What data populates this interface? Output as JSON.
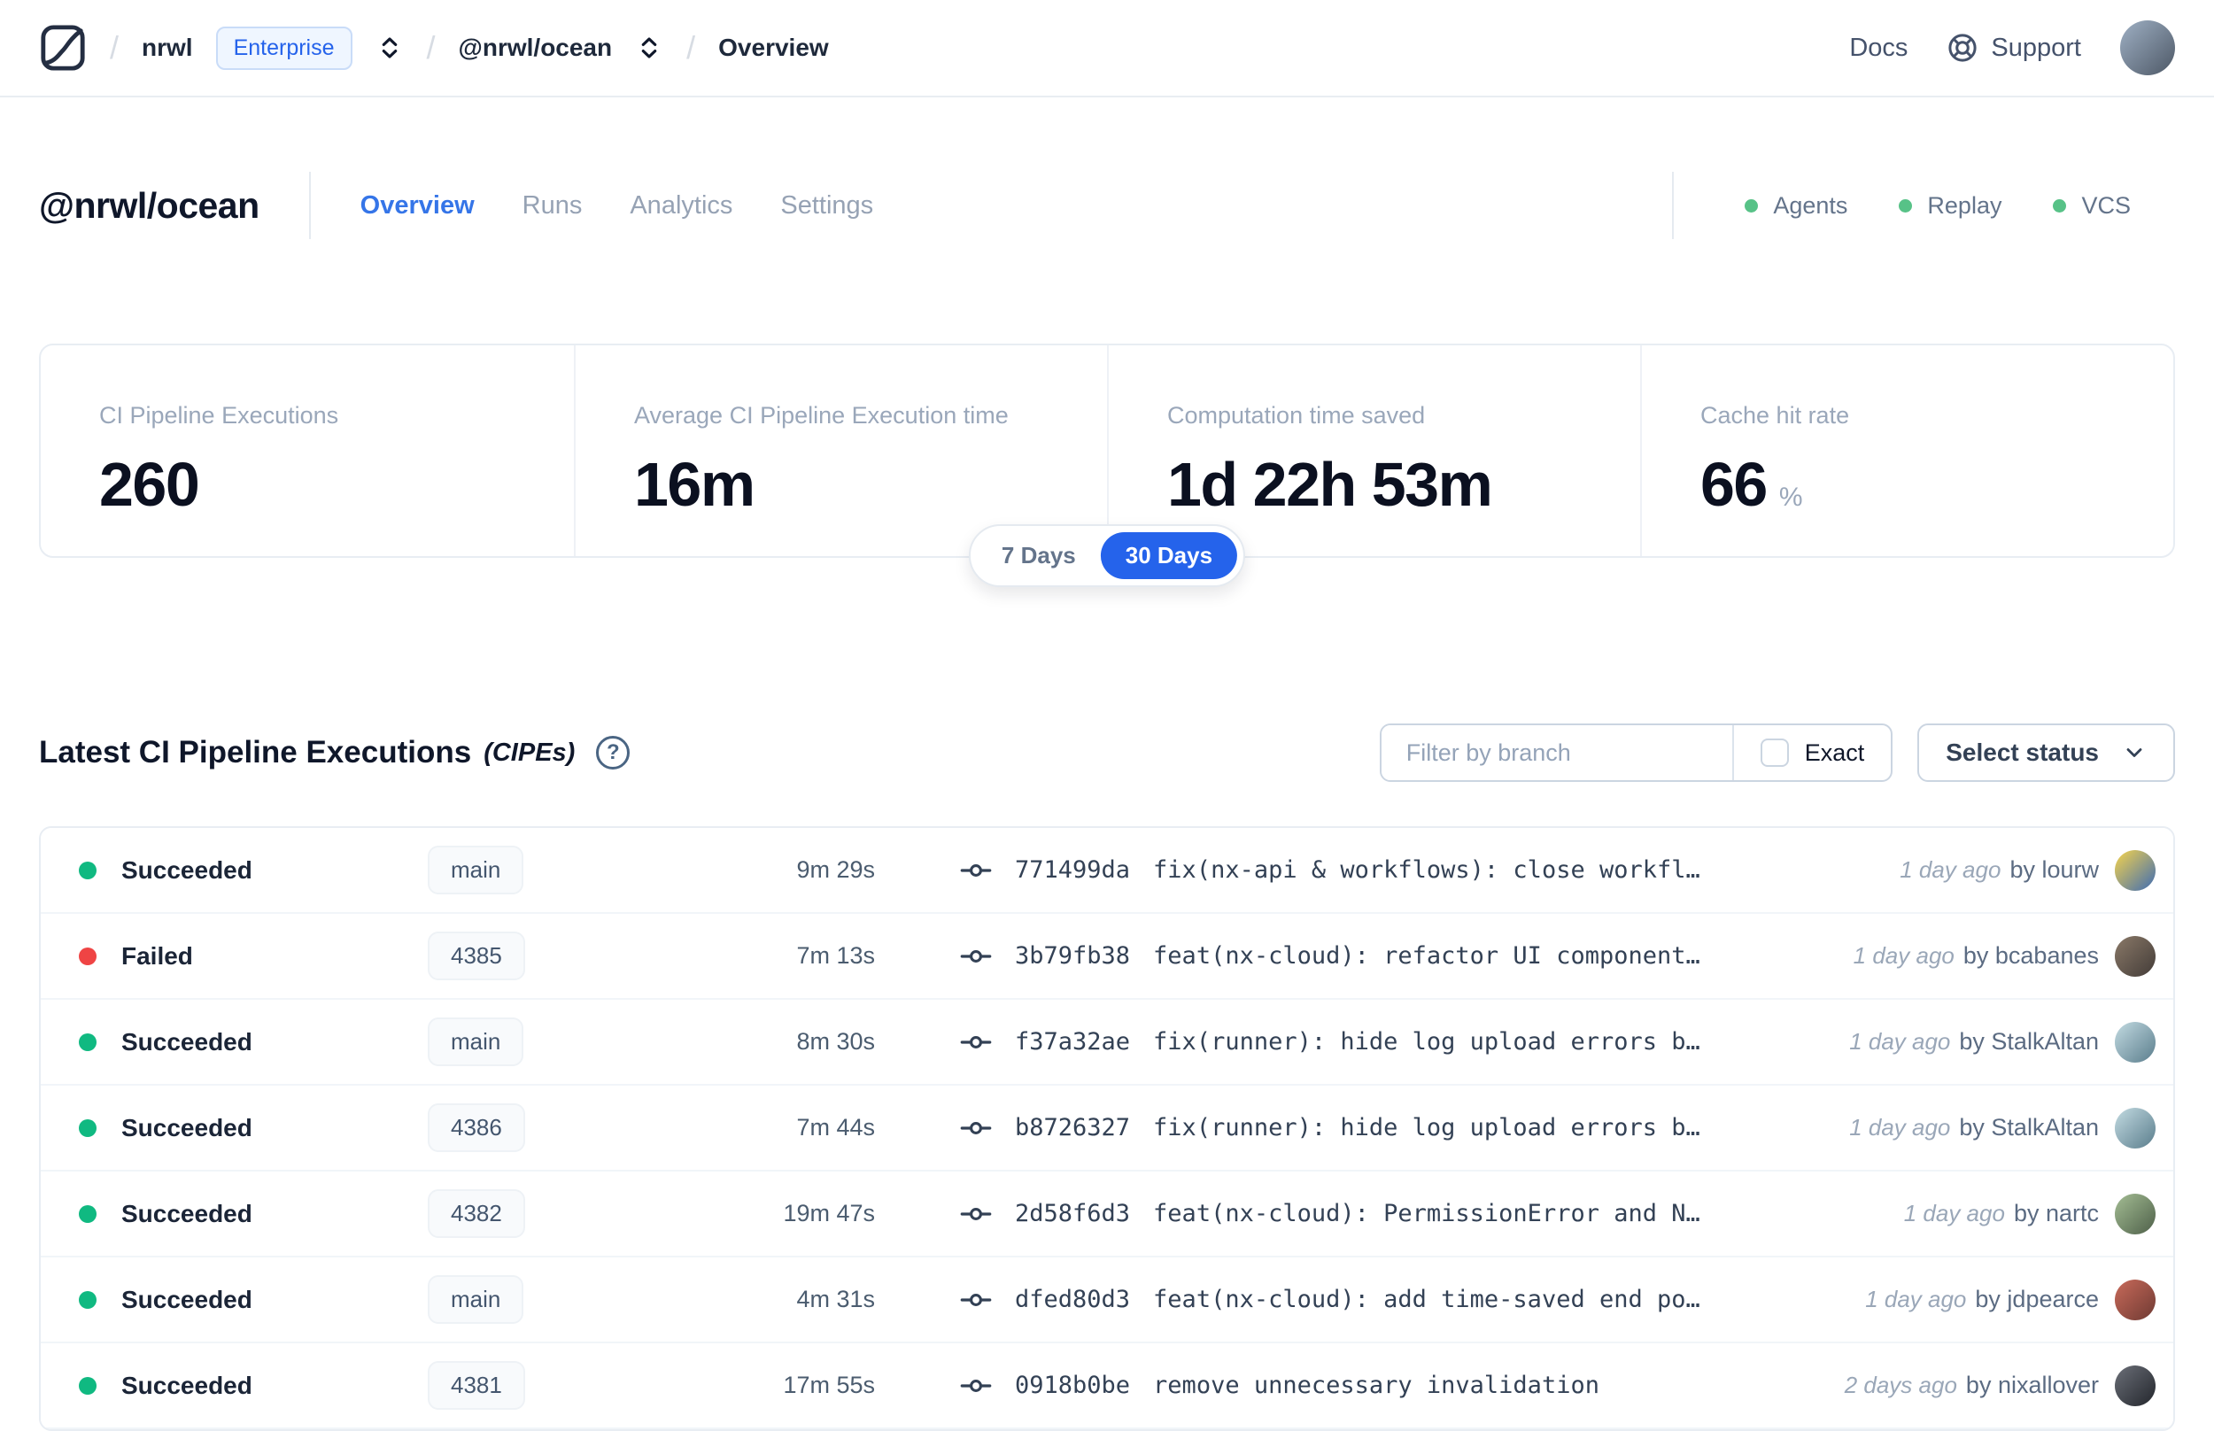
{
  "navbar": {
    "breadcrumb": {
      "org": "nrwl",
      "org_badge": "Enterprise",
      "workspace": "@nrwl/ocean",
      "page": "Overview"
    },
    "links": {
      "docs": "Docs",
      "support": "Support"
    }
  },
  "workspace_header": {
    "title": "@nrwl/ocean",
    "tabs": [
      {
        "label": "Overview",
        "active": true
      },
      {
        "label": "Runs",
        "active": false
      },
      {
        "label": "Analytics",
        "active": false
      },
      {
        "label": "Settings",
        "active": false
      }
    ],
    "integrations": [
      {
        "label": "Agents",
        "status_color": "#57c287"
      },
      {
        "label": "Replay",
        "status_color": "#57c287"
      },
      {
        "label": "VCS",
        "status_color": "#57c287"
      }
    ]
  },
  "stats": {
    "cards": [
      {
        "label": "CI Pipeline Executions",
        "value": "260",
        "suffix": ""
      },
      {
        "label": "Average CI Pipeline Execution time",
        "value": "16m",
        "suffix": ""
      },
      {
        "label": "Computation time saved",
        "value": "1d 22h 53m",
        "suffix": ""
      },
      {
        "label": "Cache hit rate",
        "value": "66",
        "suffix": "%"
      }
    ],
    "range_toggle": {
      "options": [
        "7 Days",
        "30 Days"
      ],
      "selected": "30 Days",
      "accent_color": "#2563eb"
    }
  },
  "cipes": {
    "title": "Latest CI Pipeline Executions",
    "title_qualifier": "(CIPEs)",
    "filter": {
      "placeholder": "Filter by branch",
      "exact_label": "Exact",
      "exact_checked": false
    },
    "status_dropdown_label": "Select status",
    "rows": [
      {
        "status": "Succeeded",
        "status_color": "#10b981",
        "branch": "main",
        "duration": "9m 29s",
        "commit_hash": "771499da",
        "commit_message": "fix(nx-api & workflows): close workfl…",
        "time_ago": "1 day ago",
        "author": "by lourw",
        "avatar_colors": [
          "#f7d44c",
          "#3d6bb3"
        ]
      },
      {
        "status": "Failed",
        "status_color": "#ef4444",
        "branch": "4385",
        "duration": "7m 13s",
        "commit_hash": "3b79fb38",
        "commit_message": "feat(nx-cloud): refactor UI component…",
        "time_ago": "1 day ago",
        "author": "by bcabanes",
        "avatar_colors": [
          "#8a7968",
          "#433c38"
        ]
      },
      {
        "status": "Succeeded",
        "status_color": "#10b981",
        "branch": "main",
        "duration": "8m 30s",
        "commit_hash": "f37a32ae",
        "commit_message": "fix(runner): hide log upload errors b…",
        "time_ago": "1 day ago",
        "author": "by StalkAltan",
        "avatar_colors": [
          "#c3dbe2",
          "#5a7d8c"
        ]
      },
      {
        "status": "Succeeded",
        "status_color": "#10b981",
        "branch": "4386",
        "duration": "7m 44s",
        "commit_hash": "b8726327",
        "commit_message": "fix(runner): hide log upload errors b…",
        "time_ago": "1 day ago",
        "author": "by StalkAltan",
        "avatar_colors": [
          "#c3dbe2",
          "#5a7d8c"
        ]
      },
      {
        "status": "Succeeded",
        "status_color": "#10b981",
        "branch": "4382",
        "duration": "19m 47s",
        "commit_hash": "2d58f6d3",
        "commit_message": "feat(nx-cloud): PermissionError and N…",
        "time_ago": "1 day ago",
        "author": "by nartc",
        "avatar_colors": [
          "#a4bd94",
          "#4e6049"
        ]
      },
      {
        "status": "Succeeded",
        "status_color": "#10b981",
        "branch": "main",
        "duration": "4m 31s",
        "commit_hash": "dfed80d3",
        "commit_message": "feat(nx-cloud): add time-saved end po…",
        "time_ago": "1 day ago",
        "author": "by jdpearce",
        "avatar_colors": [
          "#c96a5a",
          "#6e3a33"
        ]
      },
      {
        "status": "Succeeded",
        "status_color": "#10b981",
        "branch": "4381",
        "duration": "17m 55s",
        "commit_hash": "0918b0be",
        "commit_message": "remove unnecessary invalidation",
        "time_ago": "2 days ago",
        "author": "by nixallover",
        "avatar_colors": [
          "#6b6f78",
          "#23262c"
        ]
      }
    ]
  },
  "user": {
    "avatar_colors": [
      "#9fb0c4",
      "#4d5866"
    ]
  }
}
